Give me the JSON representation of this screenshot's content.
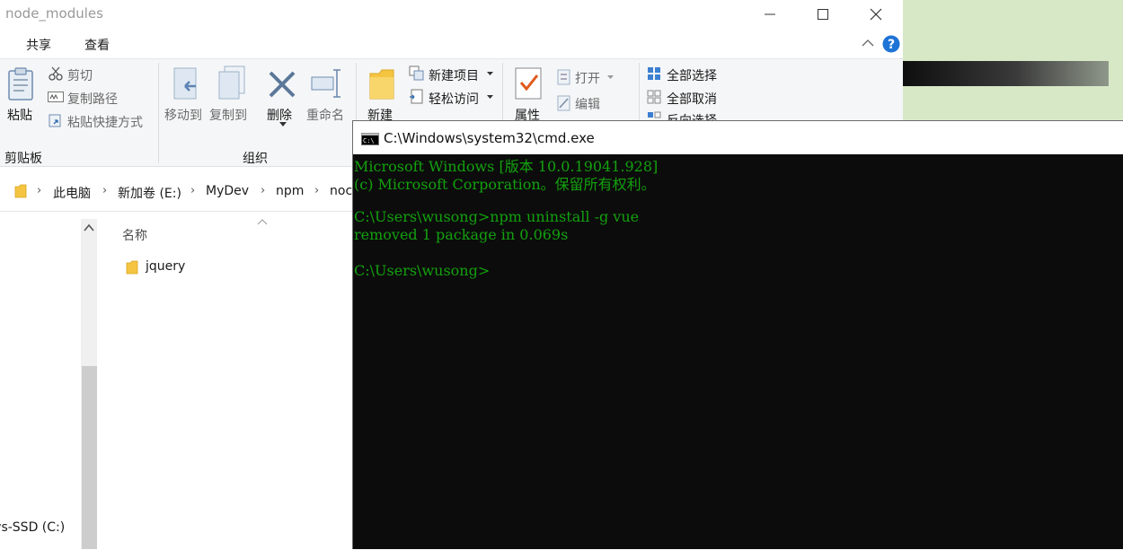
{
  "explorer": {
    "title": "node_modules",
    "window_controls": {
      "minimize": "—",
      "maximize": "☐",
      "close": "✕"
    },
    "tabs": [
      "共享",
      "查看"
    ],
    "ribbon": {
      "clipboard": {
        "paste": "粘贴",
        "cut": "剪切",
        "copy_path": "复制路径",
        "paste_shortcut": "粘贴快捷方式",
        "group_label": "剪贴板"
      },
      "organize": {
        "move_to": "移动到",
        "copy_to": "复制到",
        "delete": "删除",
        "rename": "重命名",
        "group_label": "组织"
      },
      "new": {
        "new_folder": "新建",
        "new_item": "新建项目",
        "easy_access": "轻松访问"
      },
      "open": {
        "properties": "属性",
        "open": "打开",
        "edit": "编辑"
      },
      "select": {
        "select_all": "全部选择",
        "select_none": "全部取消",
        "invert": "反向选择"
      }
    },
    "breadcrumb": [
      "此电脑",
      "新加卷 (E:)",
      "MyDev",
      "npm",
      "noc"
    ],
    "column_header": "名称",
    "files": [
      {
        "name": "jquery",
        "type": "folder"
      }
    ],
    "nav_item_bottom": "ws-SSD (C:)"
  },
  "cmd": {
    "title": "C:\\Windows\\system32\\cmd.exe",
    "icon_text": "C:\\",
    "lines": [
      "Microsoft Windows [版本 10.0.19041.928]",
      "(c) Microsoft Corporation。保留所有权利。",
      "",
      "C:\\Users\\wusong>npm uninstall -g vue",
      "removed 1 package in 0.069s",
      "",
      "C:\\Users\\wusong>"
    ],
    "text_color": "#13a10e",
    "bg_color": "#0c0c0c"
  },
  "colors": {
    "folder": "#f5c542",
    "accent_blue": "#1e73d6",
    "desktop_green": "#d7e8c6"
  }
}
